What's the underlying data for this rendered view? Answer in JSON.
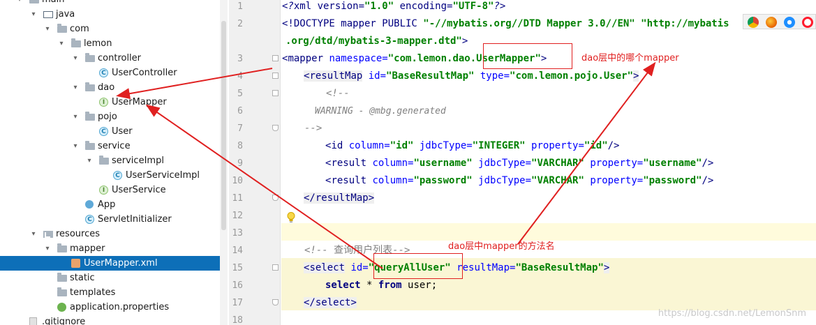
{
  "tree": {
    "items": [
      {
        "label": "main",
        "icon": "folder-icon"
      },
      {
        "label": "java",
        "icon": "source-folder-icon"
      },
      {
        "label": "com",
        "icon": "package-icon"
      },
      {
        "label": "lemon",
        "icon": "package-icon"
      },
      {
        "label": "controller",
        "icon": "package-icon"
      },
      {
        "label": "UserController",
        "icon": "class-icon"
      },
      {
        "label": "dao",
        "icon": "package-icon"
      },
      {
        "label": "UserMapper",
        "icon": "interface-icon"
      },
      {
        "label": "pojo",
        "icon": "package-icon"
      },
      {
        "label": "User",
        "icon": "class-icon"
      },
      {
        "label": "service",
        "icon": "package-icon"
      },
      {
        "label": "serviceImpl",
        "icon": "package-icon"
      },
      {
        "label": "UserServiceImpl",
        "icon": "class-icon"
      },
      {
        "label": "UserService",
        "icon": "interface-icon"
      },
      {
        "label": "App",
        "icon": "spring-boot-app-icon"
      },
      {
        "label": "ServletInitializer",
        "icon": "class-icon"
      },
      {
        "label": "resources",
        "icon": "resources-folder-icon"
      },
      {
        "label": "mapper",
        "icon": "folder-icon"
      },
      {
        "label": "UserMapper.xml",
        "icon": "xml-file-icon"
      },
      {
        "label": "static",
        "icon": "folder-icon"
      },
      {
        "label": "templates",
        "icon": "folder-icon"
      },
      {
        "label": "application.properties",
        "icon": "properties-file-icon"
      },
      {
        "label": ".gitignore",
        "icon": "file-icon"
      }
    ]
  },
  "gutter": {
    "line_numbers": [
      "1",
      "2",
      "",
      "3",
      "4",
      "5",
      "6",
      "7",
      "8",
      "9",
      "10",
      "11",
      "12",
      "13",
      "14",
      "15",
      "16",
      "17",
      "18"
    ]
  },
  "editor": {
    "l1_a": "<?",
    "l1_b": "xml version=",
    "l1_c": "\"1.0\"",
    "l1_d": " encoding=",
    "l1_e": "\"UTF-8\"",
    "l1_f": "?>",
    "l2_a": "<!DOCTYPE mapper PUBLIC ",
    "l2_b": "\"-//mybatis.org//DTD Mapper 3.0//EN\"",
    "l2_c": " \"http://mybatis",
    "l2w_a": ".org/dtd/mybatis-3-mapper.dtd\"",
    "l2w_b": ">",
    "l3_a": "<",
    "l3_b": "mapper",
    "l3_c": " namespace=",
    "l3_d": "\"com.lemon.dao.UserMapper\"",
    "l3_e": ">",
    "l4_a": "<",
    "l4_b": "resultMap",
    "l4_c": " id=",
    "l4_d": "\"BaseResultMap\"",
    "l4_e": " type=",
    "l4_f": "\"com.lemon.pojo.User\"",
    "l4_g": ">",
    "l5": "<!--",
    "l6": "WARNING - @mbg.generated",
    "l7": "-->",
    "l8_a": "<",
    "l8_b": "id",
    "l8_c": " column=",
    "l8_d": "\"id\"",
    "l8_e": " jdbcType=",
    "l8_f": "\"INTEGER\"",
    "l8_g": " property=",
    "l8_h": "\"id\"",
    "l8_i": "/>",
    "l9_a": "<",
    "l9_b": "result",
    "l9_c": " column=",
    "l9_d": "\"username\"",
    "l9_e": " jdbcType=",
    "l9_f": "\"VARCHAR\"",
    "l9_g": " property=",
    "l9_h": "\"username\"",
    "l9_i": "/>",
    "l10_a": "<",
    "l10_b": "result",
    "l10_c": " column=",
    "l10_d": "\"password\"",
    "l10_e": " jdbcType=",
    "l10_f": "\"VARCHAR\"",
    "l10_g": " property=",
    "l10_h": "\"password\"",
    "l10_i": "/>",
    "l11_a": "</",
    "l11_b": "resultMap",
    "l11_c": ">",
    "l14_a": "<!-- ",
    "l14_b": "查询用户列表",
    "l14_c": "-->",
    "l15_a": "<",
    "l15_b": "select",
    "l15_c": " id=",
    "l15_d": "\"queryAllUser\"",
    "l15_e": " resultMap=",
    "l15_f": "\"BaseResultMap\"",
    "l15_g": ">",
    "l16_a": "select",
    "l16_b": " * ",
    "l16_c": "from",
    "l16_d": " user;",
    "l17_a": "</",
    "l17_b": "select",
    "l17_c": ">"
  },
  "annotations": {
    "note_mapper": "dao层中的哪个mapper",
    "note_method": "dao层中mapper的方法名",
    "color": "#e02020"
  },
  "browser_icons": [
    "chrome-icon",
    "firefox-icon",
    "safari-icon",
    "opera-icon"
  ],
  "watermark": "https://blog.csdn.net/LemonSnm"
}
